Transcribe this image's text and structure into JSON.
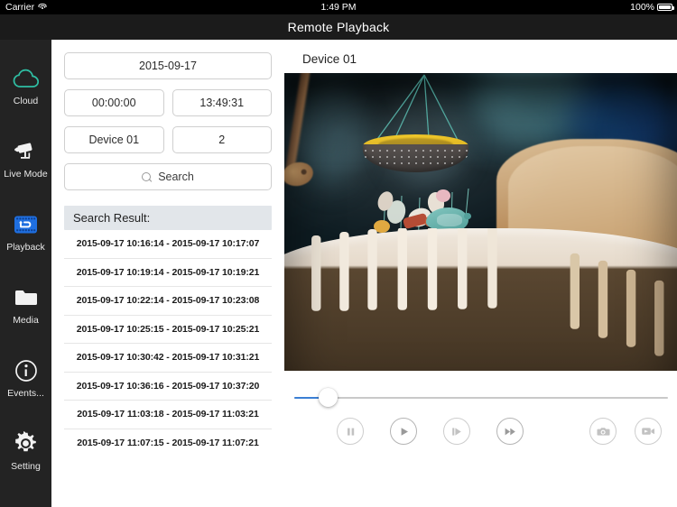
{
  "status_bar": {
    "carrier": "Carrier",
    "wifi_icon": "wifi-icon",
    "time": "1:49 PM",
    "battery_percent": "100%",
    "battery_icon": "battery-full-icon"
  },
  "navbar": {
    "title": "Remote Playback"
  },
  "sidebar": {
    "items": [
      {
        "label": "Cloud",
        "icon": "cloud-icon",
        "active": false,
        "color": "#2fbfa4"
      },
      {
        "label": "Live Mode",
        "icon": "video-camera-icon",
        "active": false,
        "color": "#ffffff"
      },
      {
        "label": "Playback",
        "icon": "playback-rewind-icon",
        "active": true,
        "color": "#1f6fe0"
      },
      {
        "label": "Media",
        "icon": "folder-icon",
        "active": false,
        "color": "#ffffff"
      },
      {
        "label": "Events...",
        "icon": "info-circle-icon",
        "active": false,
        "color": "#ffffff"
      },
      {
        "label": "Setting",
        "icon": "gear-icon",
        "active": false,
        "color": "#ffffff"
      }
    ]
  },
  "search_form": {
    "date": "2015-09-17",
    "start_time": "00:00:00",
    "end_time": "13:49:31",
    "device": "Device 01",
    "channel": "2",
    "search_button": "Search",
    "search_icon": "search-icon"
  },
  "results": {
    "header": "Search Result:",
    "rows": [
      "2015-09-17 10:16:14 - 2015-09-17 10:17:07",
      "2015-09-17 10:19:14 - 2015-09-17 10:19:21",
      "2015-09-17 10:22:14 - 2015-09-17 10:23:08",
      "2015-09-17 10:25:15 - 2015-09-17 10:25:21",
      "2015-09-17 10:30:42 - 2015-09-17 10:31:21",
      "2015-09-17 10:36:16 - 2015-09-17 10:37:20",
      "2015-09-17 11:03:18 - 2015-09-17 11:03:21",
      "2015-09-17 11:07:15 - 2015-09-17 11:07:21"
    ]
  },
  "player": {
    "device_label": "Device 01",
    "video_description": "Baby crib with hanging mobile",
    "progress_percent": 9,
    "accent_color": "#3b7fd4",
    "controls": [
      {
        "name": "pause-button",
        "icon": "pause-icon"
      },
      {
        "name": "play-button",
        "icon": "play-icon"
      },
      {
        "name": "step-forward-button",
        "icon": "step-forward-icon"
      },
      {
        "name": "fast-forward-button",
        "icon": "fast-forward-icon"
      },
      {
        "name": "snapshot-button",
        "icon": "camera-icon"
      },
      {
        "name": "record-button",
        "icon": "video-record-icon"
      }
    ]
  }
}
